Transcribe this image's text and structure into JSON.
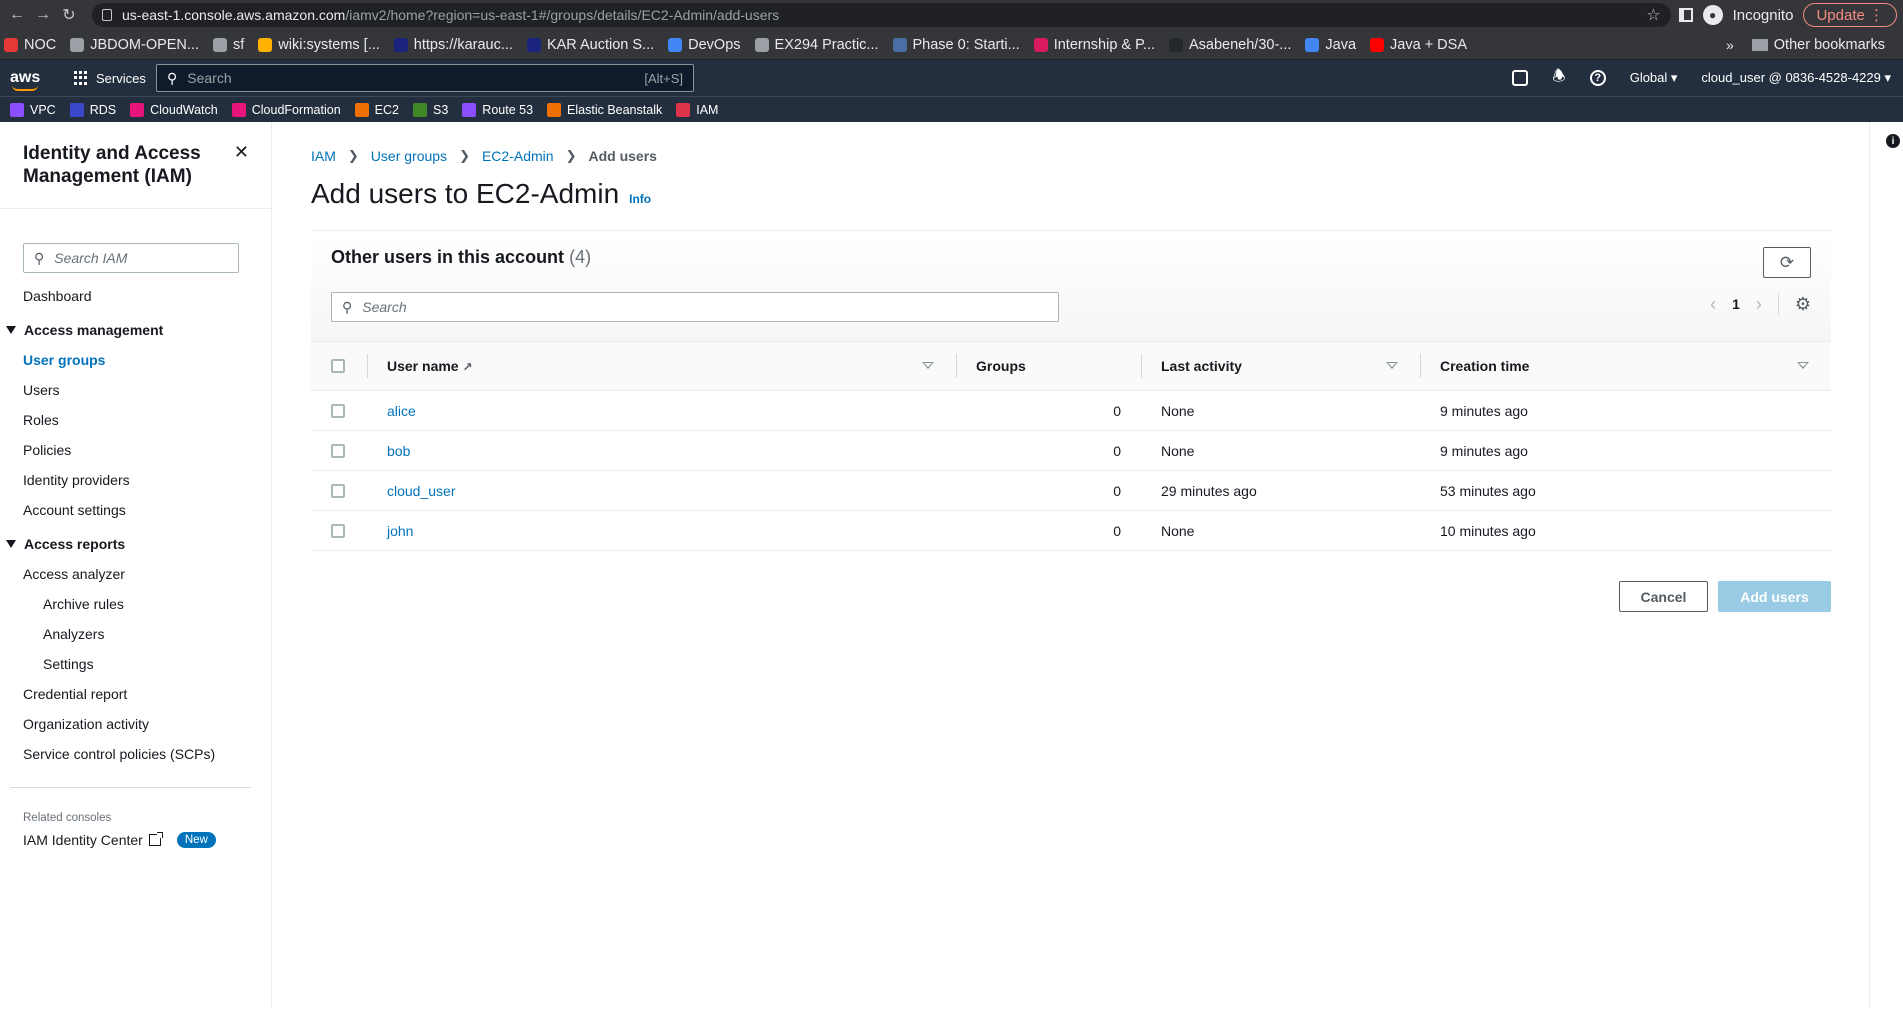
{
  "browser": {
    "url_host": "us-east-1.console.aws.amazon.com",
    "url_path": "/iamv2/home?region=us-east-1#/groups/details/EC2-Admin/add-users",
    "profile_label": "Incognito",
    "update_label": "Update"
  },
  "bookmarks": {
    "items": [
      {
        "label": "NOC",
        "color": "#e53935"
      },
      {
        "label": "JBDOM-OPEN...",
        "color": "#9aa0a6"
      },
      {
        "label": "sf",
        "color": "#9aa0a6"
      },
      {
        "label": "wiki:systems [...",
        "color": "#ffb300"
      },
      {
        "label": "https://karauc...",
        "color": "#1a237e"
      },
      {
        "label": "KAR Auction S...",
        "color": "#1a237e"
      },
      {
        "label": "DevOps",
        "color": "#4285f4"
      },
      {
        "label": "EX294 Practic...",
        "color": "#9aa0a6"
      },
      {
        "label": "Phase 0: Starti...",
        "color": "#4a6fa5"
      },
      {
        "label": "Internship & P...",
        "color": "#d81b60"
      },
      {
        "label": "Asabeneh/30-...",
        "color": "#24292e"
      },
      {
        "label": "Java",
        "color": "#4285f4"
      },
      {
        "label": "Java + DSA",
        "color": "#ff0000"
      }
    ],
    "more_label": "»",
    "other_label": "Other bookmarks"
  },
  "aws_nav": {
    "logo": "aws",
    "services_label": "Services",
    "search_placeholder": "Search",
    "search_shortcut": "[Alt+S]",
    "region_label": "Global",
    "account_label": "cloud_user @ 0836-4528-4229"
  },
  "favorites": [
    {
      "label": "VPC",
      "color": "#8c4fff"
    },
    {
      "label": "RDS",
      "color": "#3b48cc"
    },
    {
      "label": "CloudWatch",
      "color": "#e7157b"
    },
    {
      "label": "CloudFormation",
      "color": "#e7157b"
    },
    {
      "label": "EC2",
      "color": "#ed7100"
    },
    {
      "label": "S3",
      "color": "#3f8624"
    },
    {
      "label": "Route 53",
      "color": "#8c4fff"
    },
    {
      "label": "Elastic Beanstalk",
      "color": "#ed7100"
    },
    {
      "label": "IAM",
      "color": "#dd344c"
    }
  ],
  "sidebar": {
    "title": "Identity and Access Management (IAM)",
    "search_placeholder": "Search IAM",
    "dashboard": "Dashboard",
    "access_management": "Access management",
    "am_items": [
      "User groups",
      "Users",
      "Roles",
      "Policies",
      "Identity providers",
      "Account settings"
    ],
    "access_reports": "Access reports",
    "access_analyzer": "Access analyzer",
    "analyzer_items": [
      "Archive rules",
      "Analyzers",
      "Settings"
    ],
    "report_items": [
      "Credential report",
      "Organization activity",
      "Service control policies (SCPs)"
    ],
    "related_label": "Related consoles",
    "identity_center": "IAM Identity Center",
    "new_badge": "New"
  },
  "breadcrumb": {
    "items": [
      "IAM",
      "User groups",
      "EC2-Admin"
    ],
    "current": "Add users"
  },
  "page": {
    "title": "Add users to EC2-Admin",
    "info": "Info"
  },
  "panel": {
    "title": "Other users in this account",
    "count": "(4)",
    "search_placeholder": "Search",
    "page_number": "1"
  },
  "table": {
    "columns": [
      "User name",
      "Groups",
      "Last activity",
      "Creation time"
    ],
    "rows": [
      {
        "name": "alice",
        "groups": "0",
        "last_activity": "None",
        "created": "9 minutes ago"
      },
      {
        "name": "bob",
        "groups": "0",
        "last_activity": "None",
        "created": "9 minutes ago"
      },
      {
        "name": "cloud_user",
        "groups": "0",
        "last_activity": "29 minutes ago",
        "created": "53 minutes ago"
      },
      {
        "name": "john",
        "groups": "0",
        "last_activity": "None",
        "created": "10 minutes ago"
      }
    ]
  },
  "actions": {
    "cancel": "Cancel",
    "add_users": "Add users"
  }
}
